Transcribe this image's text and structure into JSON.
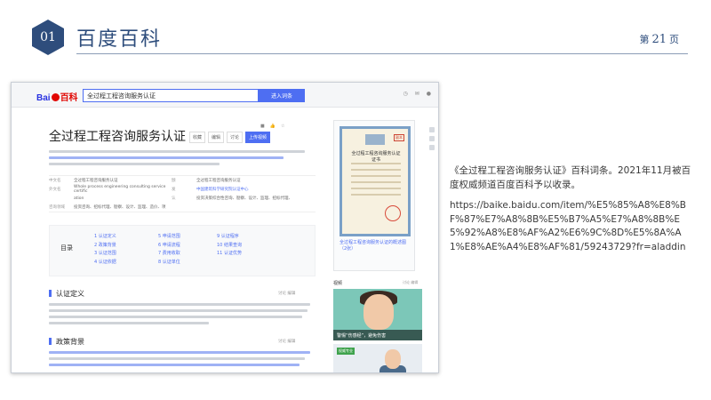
{
  "slide": {
    "badge": "01",
    "title": "百度百科",
    "page_prefix": "第",
    "page_number": "21",
    "page_suffix": "页",
    "accent_color": "#2e4d7c"
  },
  "screenshot": {
    "logo_text": "Bai",
    "logo_suffix": "百科",
    "search_value": "全过程工程咨询服务认证",
    "search_button": "进入词条",
    "article_title": "全过程工程咨询服务认证",
    "tool_buttons": [
      "收藏",
      "编辑",
      "讨论",
      "上传视频"
    ],
    "info_rows": [
      {
        "k1": "中文名",
        "v1": "全过程工程咨询服务认证",
        "k2": "颁",
        "v2": "全过程工程咨询服务认证"
      },
      {
        "k1": "外文名",
        "v1": "Whole process engineering consulting service certific",
        "k2": "发",
        "v2": "中国建筑科学研究院认证中心"
      },
      {
        "k1": "",
        "v1": "ation",
        "k2": "认",
        "v2": "投资决策综合性咨询、勘察、设计、监理、招标代理、"
      },
      {
        "k1": "咨询领域",
        "v1": "投资咨询、招标代理、勘察、设计、监理、造价、项",
        "k2": "",
        "v2": ""
      },
      {
        "k1": "",
        "v1": "目管理等专业化服务",
        "k2": "",
        "v2": ""
      }
    ],
    "toc_label": "目录",
    "toc": [
      [
        "1 认证定义",
        "2 政策背景",
        "3 认证范围",
        "4 认证依据"
      ],
      [
        "5 申请范围",
        "6 申请流程",
        "7 费用收取",
        "8 认证单位"
      ],
      [
        "9 认证程序",
        "10 结果查询",
        "11 认证优势"
      ]
    ],
    "sections": [
      "认证定义",
      "政策背景"
    ],
    "section_tools": "讨论  编辑",
    "cert_title": "全过程工程咨询服务认证证书",
    "cert_badge": "副本",
    "caption": "全过程工程咨询服务认证的概述图（2张）",
    "video_label": "视频",
    "video_tools": "讨论  编辑",
    "video1_caption": "警惕“伤感经”，避免伤害",
    "video2_tag": "权威专业"
  },
  "description": "《全过程工程咨询服务认证》百科词条。2021年11月被百度权威频道百度百科予以收录。",
  "url": "https://baike.baidu.com/item/%E5%85%A8%E8%BF%87%E7%A8%8B%E5%B7%A5%E7%A8%8B%E5%92%A8%E8%AF%A2%E6%9C%8D%E5%8A%A1%E8%AE%A4%E8%AF%81/59243729?fr=aladdin"
}
